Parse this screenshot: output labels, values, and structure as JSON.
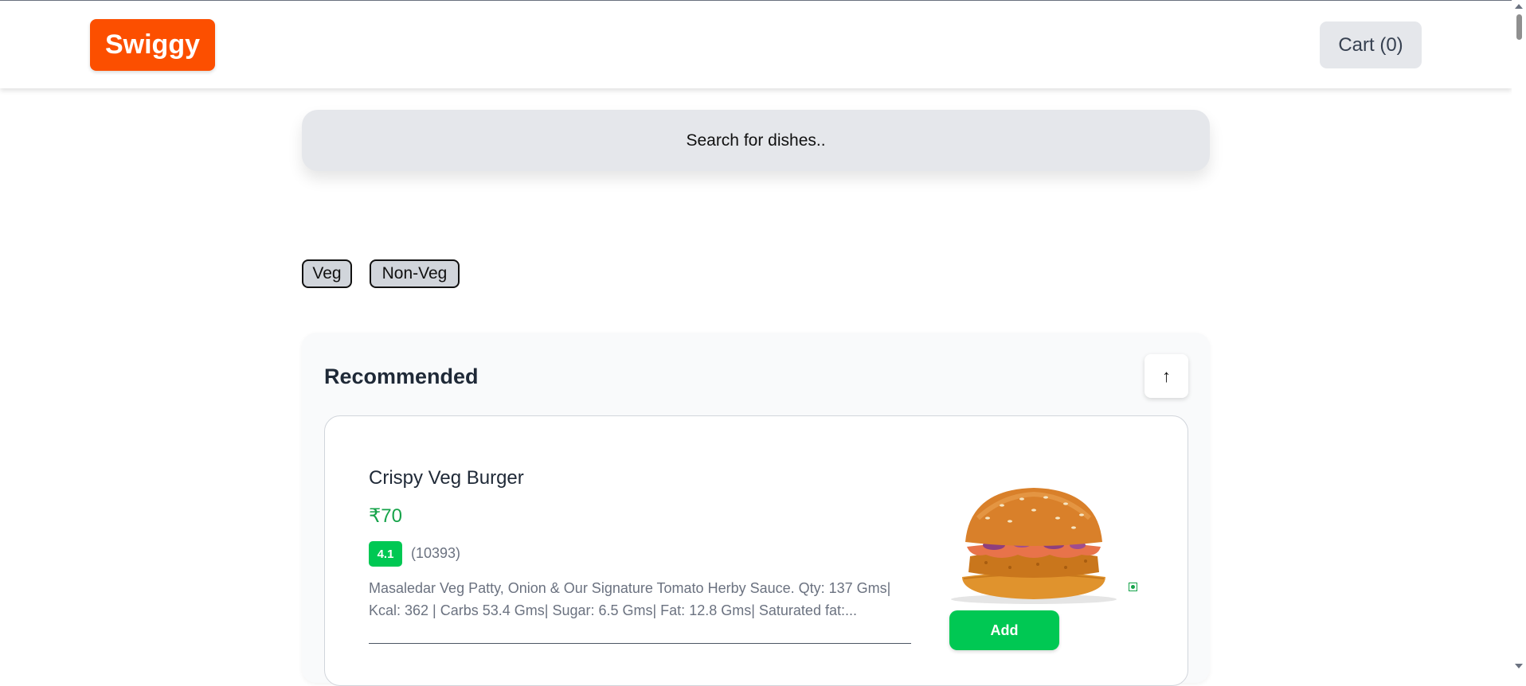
{
  "header": {
    "logo": "Swiggy",
    "cart_label": "Cart (0)"
  },
  "search": {
    "placeholder": "Search for dishes.."
  },
  "filters": [
    {
      "label": "Veg"
    },
    {
      "label": "Non-Veg"
    }
  ],
  "section": {
    "title": "Recommended",
    "collapse_symbol": "↑",
    "items": [
      {
        "name": "Crispy Veg Burger",
        "price": "₹70",
        "rating": "4.1",
        "rating_count": "(10393)",
        "description": "Masaledar Veg Patty, Onion & Our Signature Tomato Herby Sauce. Qty: 137 Gms| Kcal: 362 | Carbs 53.4 Gms| Sugar: 6.5 Gms| Fat: 12.8 Gms| Saturated fat:...",
        "add_label": "Add",
        "image": "burger-image"
      }
    ]
  },
  "colors": {
    "brand": "#fc4f00",
    "accent_green": "#00c853",
    "price_green": "#16a34a"
  }
}
